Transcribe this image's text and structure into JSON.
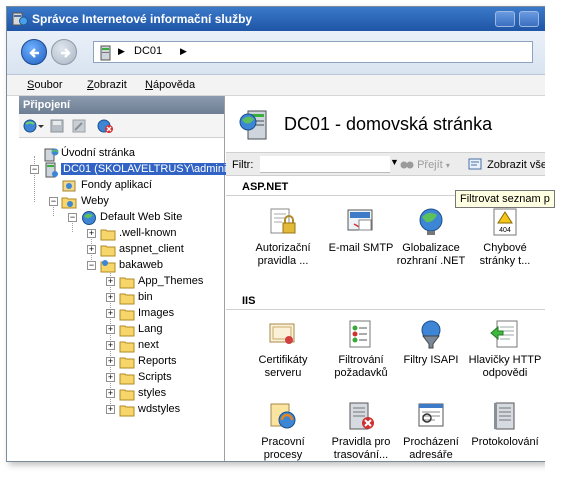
{
  "window": {
    "title": "Správce Internetové informační služby"
  },
  "address": {
    "crumb": "DC01",
    "sep": "▶"
  },
  "menu": [
    {
      "label": "Soubor"
    },
    {
      "label": "Zobrazit"
    },
    {
      "label": "Nápověda"
    }
  ],
  "connections": {
    "header": "Připojení",
    "tree": [
      {
        "label": "Úvodní stránka"
      },
      {
        "label": "DC01 (SKOLAVELTRUSY\\administ"
      },
      {
        "label": "Fondy aplikací"
      },
      {
        "label": "Weby"
      },
      {
        "label": "Default Web Site"
      },
      {
        "label": ".well-known"
      },
      {
        "label": "aspnet_client"
      },
      {
        "label": "bakaweb"
      },
      {
        "label": "App_Themes"
      },
      {
        "label": "bin"
      },
      {
        "label": "Images"
      },
      {
        "label": "Lang"
      },
      {
        "label": "next"
      },
      {
        "label": "Reports"
      },
      {
        "label": "Scripts"
      },
      {
        "label": "styles"
      },
      {
        "label": "wdstyles"
      }
    ]
  },
  "home": {
    "title": "DC01 - domovská stránka",
    "filter_label": "Filtr:",
    "filter_value": "",
    "go_label": "Přejít",
    "show_all_label": "Zobrazit vše",
    "tooltip": "Filtrovat seznam p"
  },
  "sections": [
    {
      "name": "ASP.NET",
      "features": [
        {
          "label": "Autorizační pravidla ...",
          "icon": "lock-icon"
        },
        {
          "label": "E-mail SMTP",
          "icon": "email-icon"
        },
        {
          "label": "Globalizace rozhraní .NET",
          "icon": "globe-icon"
        },
        {
          "label": "Chybové stránky t...",
          "icon": "warning-404-icon"
        }
      ]
    },
    {
      "name": "IIS",
      "features": [
        {
          "label": "Certifikáty serveru",
          "icon": "certificate-icon"
        },
        {
          "label": "Filtrování požadavků",
          "icon": "filter-list-icon"
        },
        {
          "label": "Filtry ISAPI",
          "icon": "funnel-icon"
        },
        {
          "label": "Hlavičky HTTP odpovědi",
          "icon": "http-headers-icon"
        },
        {
          "label": "Pracovní procesy",
          "icon": "worker-process-icon"
        },
        {
          "label": "Pravidla pro trasování...",
          "icon": "tracing-rules-icon"
        },
        {
          "label": "Procházení adresáře",
          "icon": "directory-browse-icon"
        },
        {
          "label": "Protokolování",
          "icon": "logging-icon"
        }
      ]
    }
  ],
  "colors": {
    "title_bar": "#1f55a6",
    "selection": "#3163c5",
    "folder": "#f6d66b"
  }
}
